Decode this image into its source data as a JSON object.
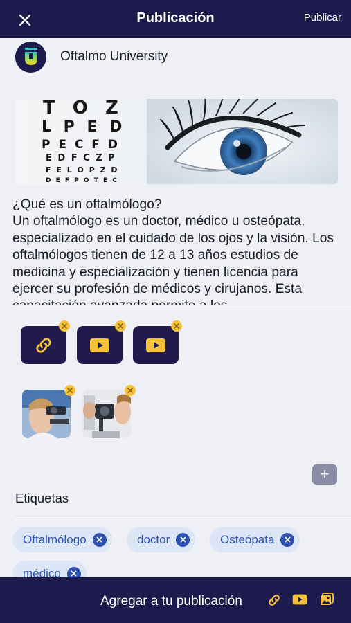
{
  "header": {
    "title": "Publicación",
    "publish_label": "Publicar",
    "close_icon": "close-icon"
  },
  "author": {
    "name": "Oftalmo University"
  },
  "banner": {
    "chart_rows": [
      "T O Z",
      "L P E D",
      "P E C F D",
      "E D F C Z P",
      "F E L O P Z D",
      "D E F P O T E C"
    ]
  },
  "post": {
    "text": "¿Qué es un oftalmólogo?\nUn oftalmólogo es un doctor, médico u osteópata, especializado en el cuidado de los ojos y la visión. Los oftalmólogos tienen de 12 a 13 años estudios de medicina y especialización y tienen licencia para ejercer su profesión de médicos y cirujanos. Esta capacitación avanzada permite a los"
  },
  "attachments": [
    {
      "type": "link",
      "icon": "link-icon"
    },
    {
      "type": "video",
      "icon": "play-icon"
    },
    {
      "type": "video",
      "icon": "play-icon"
    }
  ],
  "images": [
    {
      "subject": "eye-exam-photo"
    },
    {
      "subject": "slit-lamp-photo"
    }
  ],
  "add_button": "+",
  "tags": {
    "title": "Etiquetas",
    "items": [
      "Oftalmólogo",
      "doctor",
      "Osteópata",
      "médico"
    ]
  },
  "bottom_bar": {
    "label": "Agregar a tu publicación",
    "icons": [
      "link-icon",
      "play-icon",
      "gallery-icon"
    ]
  },
  "colors": {
    "primary": "#1d1b4d",
    "accent": "#f5c23a",
    "chip_bg": "#dde6f6",
    "chip_text": "#2c52b8"
  }
}
